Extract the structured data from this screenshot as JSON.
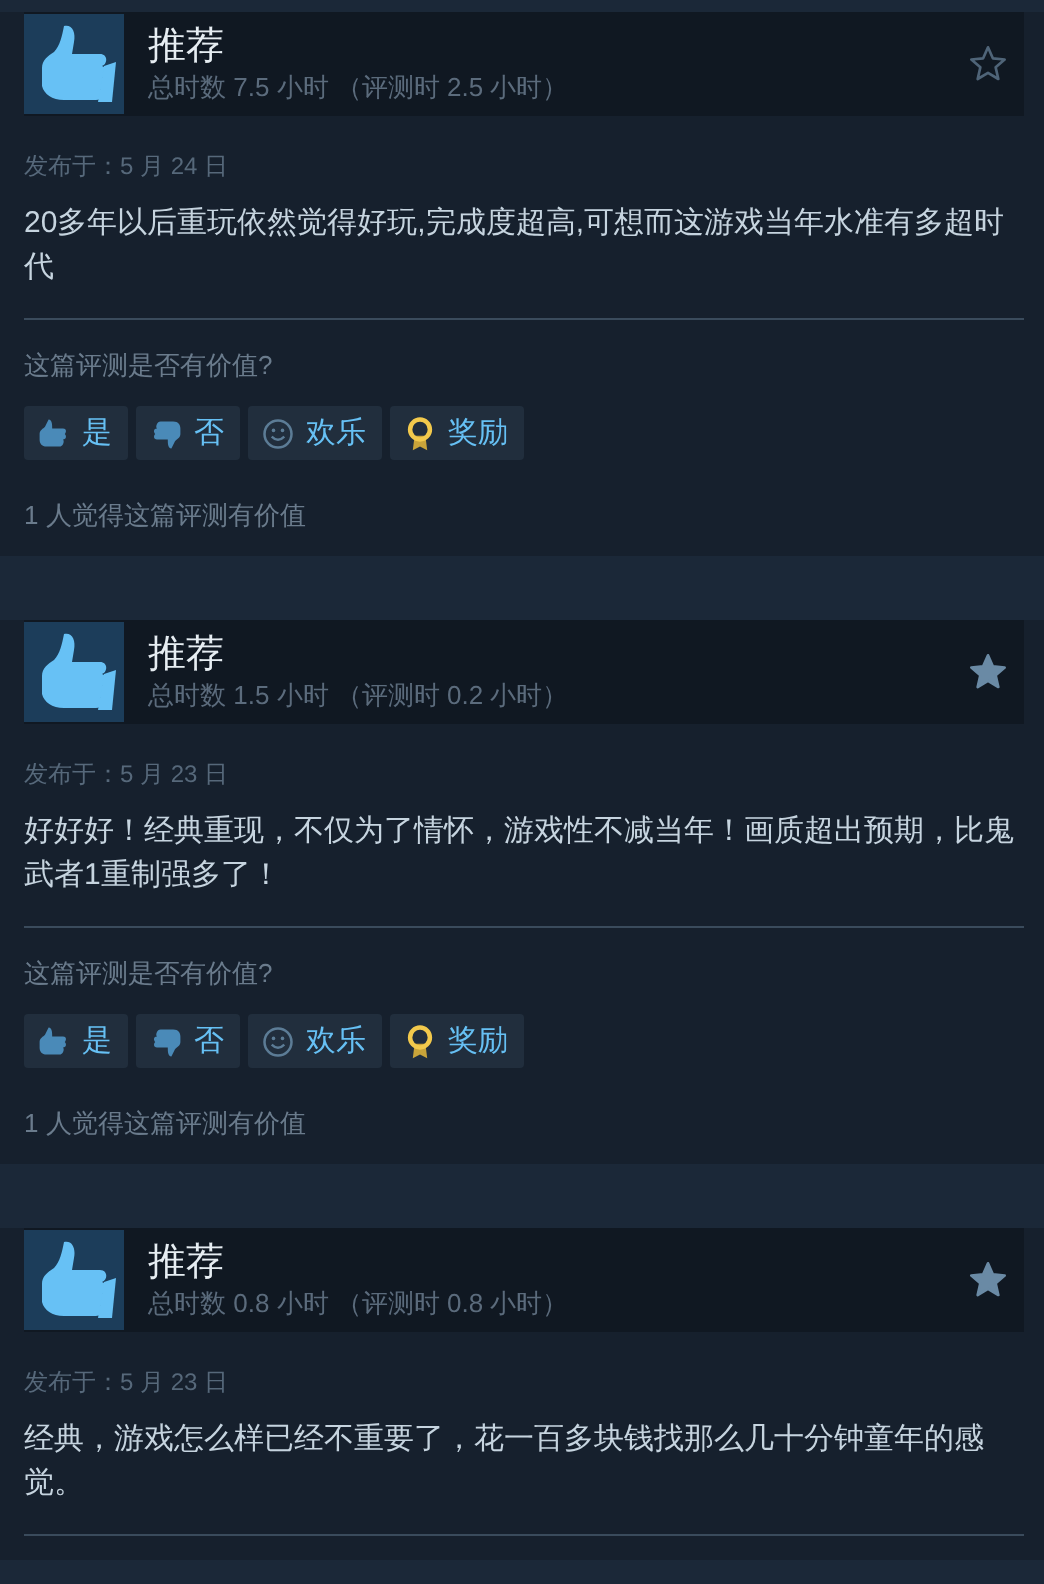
{
  "reviews": [
    {
      "title": "推荐",
      "hours": "总时数 7.5 小时 （评测时 2.5 小时）",
      "starred": false,
      "date": "发布于：5 月 24 日",
      "text": "20多年以后重玩依然觉得好玩,完成度超高,可想而这游戏当年水准有多超时代",
      "question": "这篇评测是否有价值?",
      "buttons": [
        {
          "kind": "yes",
          "label": "是"
        },
        {
          "kind": "no",
          "label": "否"
        },
        {
          "kind": "funny",
          "label": "欢乐"
        },
        {
          "kind": "award",
          "label": "奖励"
        }
      ],
      "helpful": "1 人觉得这篇评测有价值"
    },
    {
      "title": "推荐",
      "hours": "总时数 1.5 小时 （评测时 0.2 小时）",
      "starred": true,
      "date": "发布于：5 月 23 日",
      "text": "好好好！经典重现，不仅为了情怀，游戏性不减当年！画质超出预期，比鬼武者1重制强多了！",
      "question": "这篇评测是否有价值?",
      "buttons": [
        {
          "kind": "yes",
          "label": "是"
        },
        {
          "kind": "no",
          "label": "否"
        },
        {
          "kind": "funny",
          "label": "欢乐"
        },
        {
          "kind": "award",
          "label": "奖励"
        }
      ],
      "helpful": "1 人觉得这篇评测有价值"
    },
    {
      "title": "推荐",
      "hours": "总时数 0.8 小时 （评测时 0.8 小时）",
      "starred": true,
      "date": "发布于：5 月 23 日",
      "text": "经典，游戏怎么样已经不重要了，花一百多块钱找那么几十分钟童年的感觉。"
    }
  ]
}
